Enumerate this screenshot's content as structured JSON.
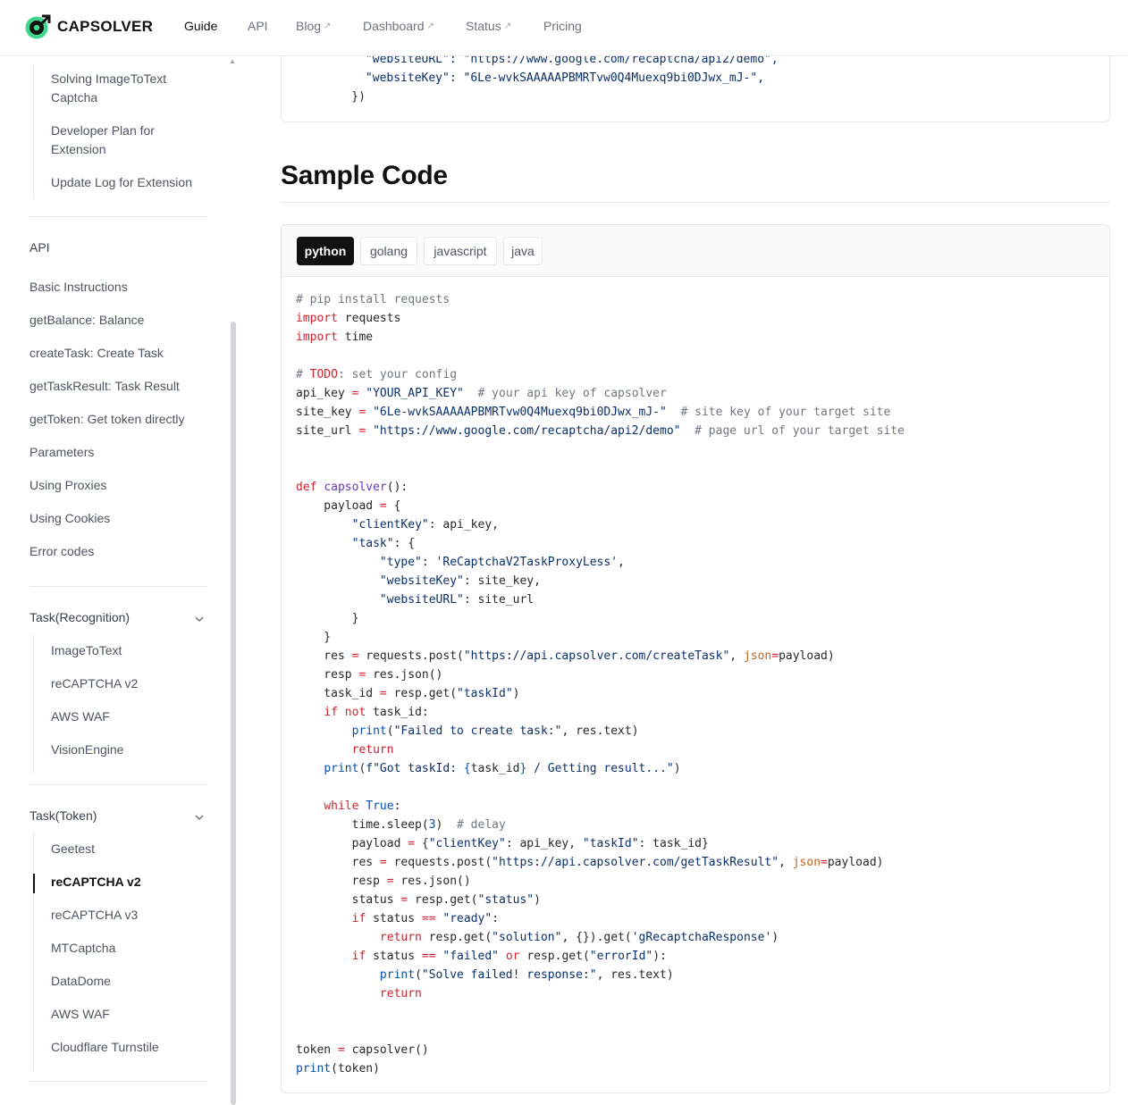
{
  "header": {
    "brand": "CAPSOLVER",
    "nav": [
      {
        "label": "Guide",
        "external": false,
        "active": true
      },
      {
        "label": "API",
        "external": false,
        "active": false
      },
      {
        "label": "Blog",
        "external": true,
        "active": false
      },
      {
        "label": "Dashboard",
        "external": true,
        "active": false
      },
      {
        "label": "Status",
        "external": true,
        "active": false
      },
      {
        "label": "Pricing",
        "external": false,
        "active": false
      }
    ],
    "external_glyph": "↗"
  },
  "sidebar": {
    "top_items": [
      "Solving ImageToText",
      "Captcha",
      "Developer Plan for",
      "Extension",
      "Update Log for Extension"
    ],
    "api_heading": "API",
    "api_items": [
      "Basic Instructions",
      "getBalance: Balance",
      "createTask: Create Task",
      "getTaskResult: Task Result",
      "getToken: Get token directly",
      "Parameters",
      "Using Proxies",
      "Using Cookies",
      "Error codes"
    ],
    "recognition_heading": "Task(Recognition)",
    "recognition_items": [
      "ImageToText",
      "reCAPTCHA v2",
      "AWS WAF",
      "VisionEngine"
    ],
    "token_heading": "Task(Token)",
    "token_items": [
      "Geetest",
      "reCAPTCHA v2",
      "reCAPTCHA v3",
      "MTCaptcha",
      "DataDome",
      "AWS WAF",
      "Cloudflare Turnstile"
    ],
    "active_item": "reCAPTCHA v2"
  },
  "main": {
    "top_code_lines": [
      "            \"websiteURL\": \"https://www.google.com/recaptcha/api2/demo\",",
      "            \"websiteKey\": \"6Le-wvkSAAAAAPBMRTvw0Q4Muexq9bi0DJwx_mJ-\",",
      "          })"
    ],
    "section_title": "Sample Code",
    "tabs": [
      "python",
      "golang",
      "javascript",
      "java"
    ],
    "active_tab": "python"
  },
  "colors": {
    "accent": "#111111",
    "logo_green": "#3dd68c",
    "border": "#e5e7eb"
  }
}
